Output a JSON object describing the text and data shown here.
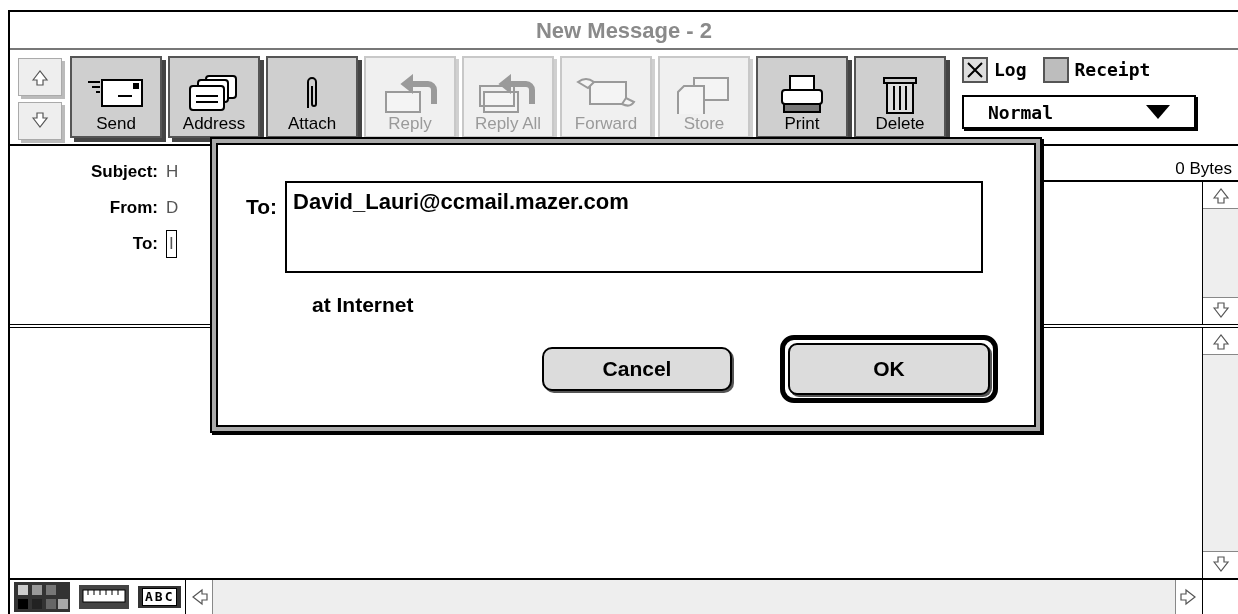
{
  "window": {
    "title": "New Message - 2"
  },
  "toolbar": {
    "buttons": [
      {
        "label": "Send",
        "disabled": false
      },
      {
        "label": "Address",
        "disabled": false
      },
      {
        "label": "Attach",
        "disabled": false
      },
      {
        "label": "Reply",
        "disabled": true
      },
      {
        "label": "Reply All",
        "disabled": true
      },
      {
        "label": "Forward",
        "disabled": true
      },
      {
        "label": "Store",
        "disabled": true
      },
      {
        "label": "Print",
        "disabled": false
      },
      {
        "label": "Delete",
        "disabled": false
      }
    ]
  },
  "options": {
    "checkboxes": [
      {
        "label": "Log",
        "checked": true
      },
      {
        "label": "Receipt",
        "checked": false
      }
    ],
    "priority": {
      "value": "Normal"
    }
  },
  "header": {
    "fields": [
      {
        "label": "Subject:",
        "value": "H",
        "kind": "text"
      },
      {
        "label": "From:",
        "value": "D",
        "kind": "text"
      },
      {
        "label": "To:",
        "value": "I",
        "kind": "box"
      }
    ],
    "size": "0 Bytes"
  },
  "format_bar": {
    "spell_label": "ABC"
  },
  "dialog": {
    "label": "To:",
    "value": "David_Lauri@ccmail.mazer.com",
    "note": "at Internet",
    "buttons": [
      {
        "label": "Cancel",
        "default": false
      },
      {
        "label": "OK",
        "default": true
      }
    ]
  }
}
